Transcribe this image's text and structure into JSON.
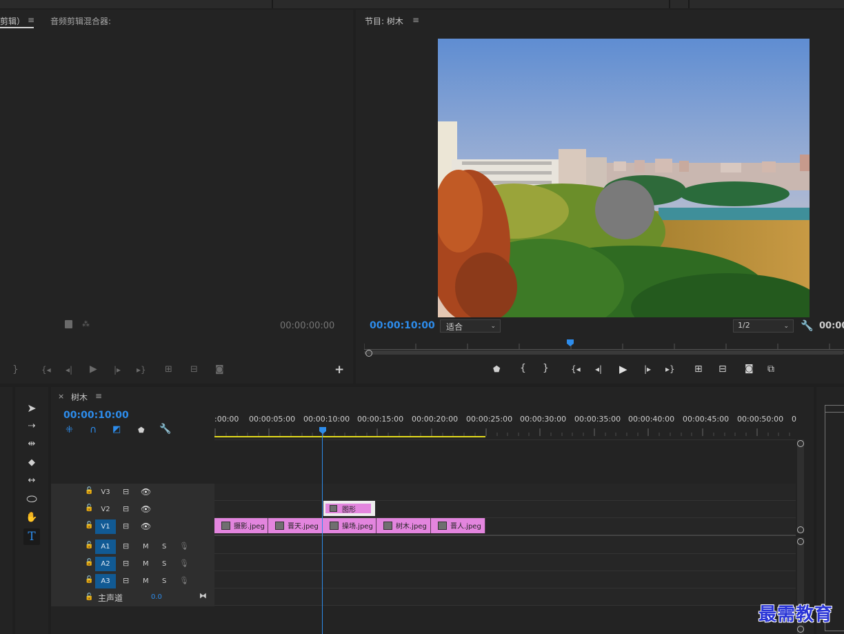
{
  "source_panel": {
    "tab_partial": "剪辑）",
    "tab_menu": "≡",
    "audio_mixer_tab": "音频剪辑混合器:",
    "timecode": "00:00:00:00"
  },
  "program_panel": {
    "title": "节目: 树木",
    "menu": "≡",
    "timecode": "00:00:10:00",
    "fit_label": "适合",
    "quality": "1/2",
    "end_timecode_partial": "00:00"
  },
  "timeline": {
    "close": "×",
    "title": "树木",
    "menu": "≡",
    "timecode": "00:00:10:00",
    "ruler_labels": [
      ":00:00",
      "00:00:05:00",
      "00:00:10:00",
      "00:00:15:00",
      "00:00:20:00",
      "00:00:25:00",
      "00:00:30:00",
      "00:00:35:00",
      "00:00:40:00",
      "00:00:45:00",
      "00:00:50:00",
      "0"
    ],
    "video_tracks": [
      {
        "label": "V3"
      },
      {
        "label": "V2"
      },
      {
        "label": "V1"
      }
    ],
    "audio_tracks": [
      {
        "label": "A1",
        "m": "M",
        "s": "S"
      },
      {
        "label": "A2",
        "m": "M",
        "s": "S"
      },
      {
        "label": "A3",
        "m": "M",
        "s": "S"
      }
    ],
    "master": {
      "label": "主声道",
      "value": "0.0"
    },
    "v2_clip": "图形",
    "v1_clips": [
      "摄影.jpeg",
      "晋天.jpeg",
      "操场.jpeg",
      "树木.jpeg",
      "晋人.jpeg"
    ]
  },
  "watermark": "最需教育",
  "colors": {
    "accent_blue": "#2d8ceb",
    "clip_pink": "#e385de",
    "work_area_yellow": "#e5dc1c"
  }
}
